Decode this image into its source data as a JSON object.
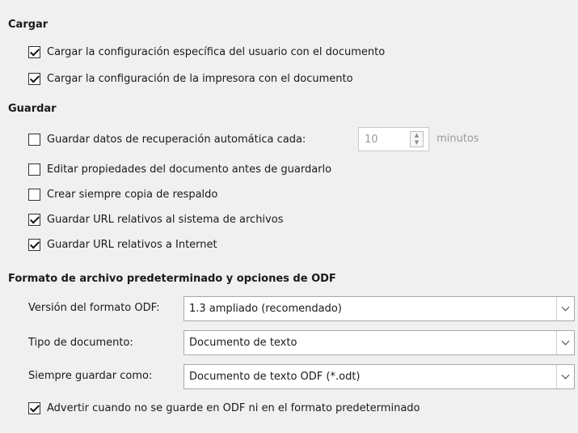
{
  "load": {
    "heading": "Cargar",
    "items": [
      {
        "label": "Cargar la configuración específica del usuario con el documento",
        "checked": true
      },
      {
        "label": "Cargar la configuración de la impresora con el documento",
        "checked": true
      }
    ]
  },
  "save": {
    "heading": "Guardar",
    "autorecovery": {
      "label": "Guardar datos de recuperación automática cada:",
      "checked": false,
      "value": "10",
      "unit": "minutos"
    },
    "items": [
      {
        "label": "Editar propiedades del documento antes de guardarlo",
        "checked": false
      },
      {
        "label": "Crear siempre copia de respaldo",
        "checked": false
      },
      {
        "label": "Guardar URL relativos al sistema de archivos",
        "checked": true
      },
      {
        "label": "Guardar URL relativos a Internet",
        "checked": true
      }
    ]
  },
  "format": {
    "heading": "Formato de archivo predeterminado y opciones de ODF",
    "odf_version": {
      "label": "Versión del formato ODF:",
      "value": "1.3 ampliado (recomendado)"
    },
    "doc_type": {
      "label": "Tipo de documento:",
      "value": "Documento de texto"
    },
    "always_save_as": {
      "label": "Siempre guardar como:",
      "value": "Documento de texto ODF (*.odt)"
    },
    "warn": {
      "label": "Advertir cuando no se guarde en ODF ni en el formato predeterminado",
      "checked": true
    }
  }
}
